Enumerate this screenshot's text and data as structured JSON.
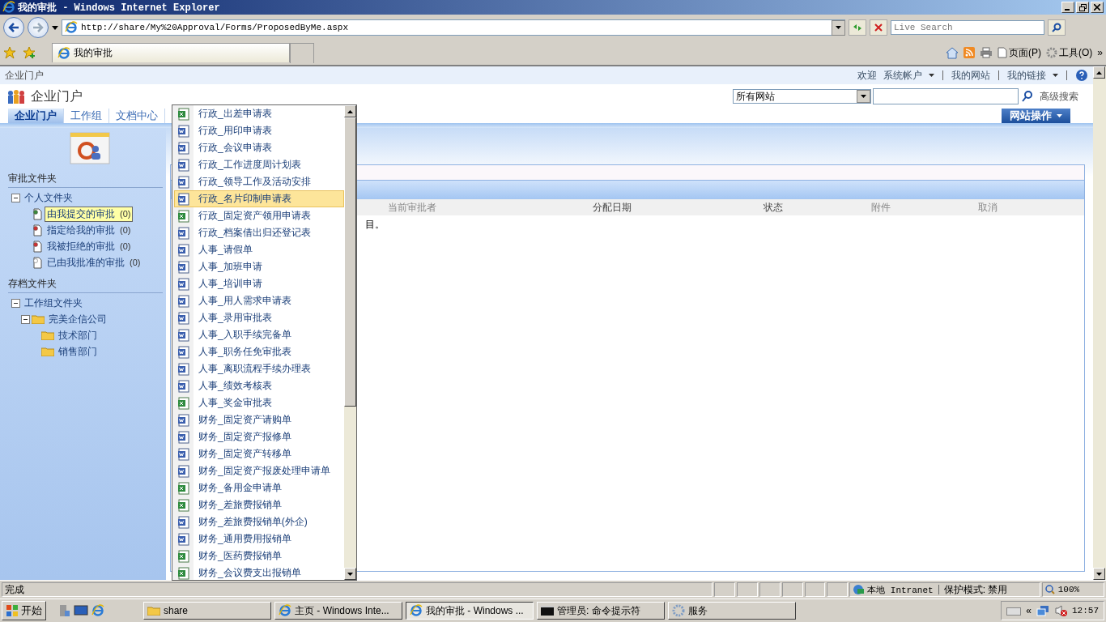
{
  "window": {
    "title": "我的审批 - Windows Internet Explorer"
  },
  "address_bar": {
    "url": "http://share/My%20Approval/Forms/ProposedByMe.aspx",
    "search_placeholder": "Live Search"
  },
  "browser_tabs": [
    {
      "label": "我的审批",
      "selected": true
    }
  ],
  "command_bar": {
    "page_menu": "页面(P)",
    "tools_menu": "工具(O)",
    "more": "»"
  },
  "site": {
    "breadcrumb": "企业门户",
    "welcome": "欢迎",
    "account": "系统帐户",
    "my_site": "我的网站",
    "my_links": "我的链接",
    "title": "企业门户",
    "search_scope": "所有网站",
    "advanced_search": "高级搜索",
    "site_actions": "网站操作",
    "tabs": [
      {
        "label": "企业门户",
        "selected": true
      },
      {
        "label": "工作组",
        "selected": false
      },
      {
        "label": "文档中心",
        "selected": false
      }
    ]
  },
  "sidebar": {
    "approval_heading": "审批文件夹",
    "approval_tree": [
      {
        "label": "个人文件夹",
        "expanded": true,
        "children": [
          {
            "label": "由我提交的审批",
            "count": "(0)",
            "kind": "submitted",
            "selected": true
          },
          {
            "label": "指定给我的审批",
            "count": "(0)",
            "kind": "assigned",
            "selected": false
          },
          {
            "label": "我被拒绝的审批",
            "count": "(0)",
            "kind": "rejected",
            "selected": false
          },
          {
            "label": "已由我批准的审批",
            "count": "(0)",
            "kind": "approved",
            "selected": false
          }
        ]
      }
    ],
    "archive_heading": "存档文件夹",
    "archive_tree": [
      {
        "label": "工作组文件夹",
        "expanded": true,
        "children": [
          {
            "label": "完美企信公司",
            "expanded": true,
            "children": [
              {
                "label": "技术部门"
              },
              {
                "label": "销售部门"
              }
            ]
          }
        ]
      }
    ]
  },
  "table": {
    "columns": [
      "当前审批者",
      "分配日期",
      "状态",
      "附件",
      "取消"
    ],
    "empty_message": "目。"
  },
  "dropdown": {
    "items": [
      {
        "label": "行政_出差申请表",
        "kind": "excel",
        "selected": false
      },
      {
        "label": "行政_用印申请表",
        "kind": "word",
        "selected": false
      },
      {
        "label": "行政_会议申请表",
        "kind": "word",
        "selected": false
      },
      {
        "label": "行政_工作进度周计划表",
        "kind": "word",
        "selected": false
      },
      {
        "label": "行政_领导工作及活动安排",
        "kind": "word",
        "selected": false
      },
      {
        "label": "行政_名片印制申请表",
        "kind": "word",
        "selected": true
      },
      {
        "label": "行政_固定资产领用申请表",
        "kind": "excel",
        "selected": false
      },
      {
        "label": "行政_档案借出归还登记表",
        "kind": "word",
        "selected": false
      },
      {
        "label": "人事_请假单",
        "kind": "word",
        "selected": false
      },
      {
        "label": "人事_加班申请",
        "kind": "word",
        "selected": false
      },
      {
        "label": "人事_培训申请",
        "kind": "word",
        "selected": false
      },
      {
        "label": "人事_用人需求申请表",
        "kind": "word",
        "selected": false
      },
      {
        "label": "人事_录用审批表",
        "kind": "word",
        "selected": false
      },
      {
        "label": "人事_入职手续完备单",
        "kind": "word",
        "selected": false
      },
      {
        "label": "人事_职务任免审批表",
        "kind": "word",
        "selected": false
      },
      {
        "label": "人事_离职流程手续办理表",
        "kind": "word",
        "selected": false
      },
      {
        "label": "人事_绩效考核表",
        "kind": "word",
        "selected": false
      },
      {
        "label": "人事_奖金审批表",
        "kind": "excel",
        "selected": false
      },
      {
        "label": "财务_固定资产请购单",
        "kind": "word",
        "selected": false
      },
      {
        "label": "财务_固定资产报修单",
        "kind": "word",
        "selected": false
      },
      {
        "label": "财务_固定资产转移单",
        "kind": "word",
        "selected": false
      },
      {
        "label": "财务_固定资产报废处理申请单",
        "kind": "word",
        "selected": false
      },
      {
        "label": "财务_备用金申请单",
        "kind": "excel",
        "selected": false
      },
      {
        "label": "财务_差旅费报销单",
        "kind": "excel",
        "selected": false
      },
      {
        "label": "财务_差旅费报销单(外企)",
        "kind": "word",
        "selected": false
      },
      {
        "label": "财务_通用费用报销单",
        "kind": "word",
        "selected": false
      },
      {
        "label": "财务_医药费报销单",
        "kind": "excel",
        "selected": false
      },
      {
        "label": "财务_会议费支出报销单",
        "kind": "excel",
        "selected": false
      }
    ]
  },
  "status_bar": {
    "text": "完成",
    "zone": "本地 Intranet",
    "protected_mode": "保护模式: 禁用",
    "zoom": "100%"
  },
  "taskbar": {
    "start": "开始",
    "tasks": [
      {
        "label": "share",
        "kind": "folder",
        "selected": false
      },
      {
        "label": "主页 - Windows Inte...",
        "kind": "ie",
        "selected": false
      },
      {
        "label": "我的审批 - Windows ...",
        "kind": "ie",
        "selected": true
      },
      {
        "label": "管理员: 命令提示符",
        "kind": "cmd",
        "selected": false
      },
      {
        "label": "服务",
        "kind": "gear",
        "selected": false
      }
    ],
    "tray_expand": "«",
    "clock": "12:57"
  }
}
